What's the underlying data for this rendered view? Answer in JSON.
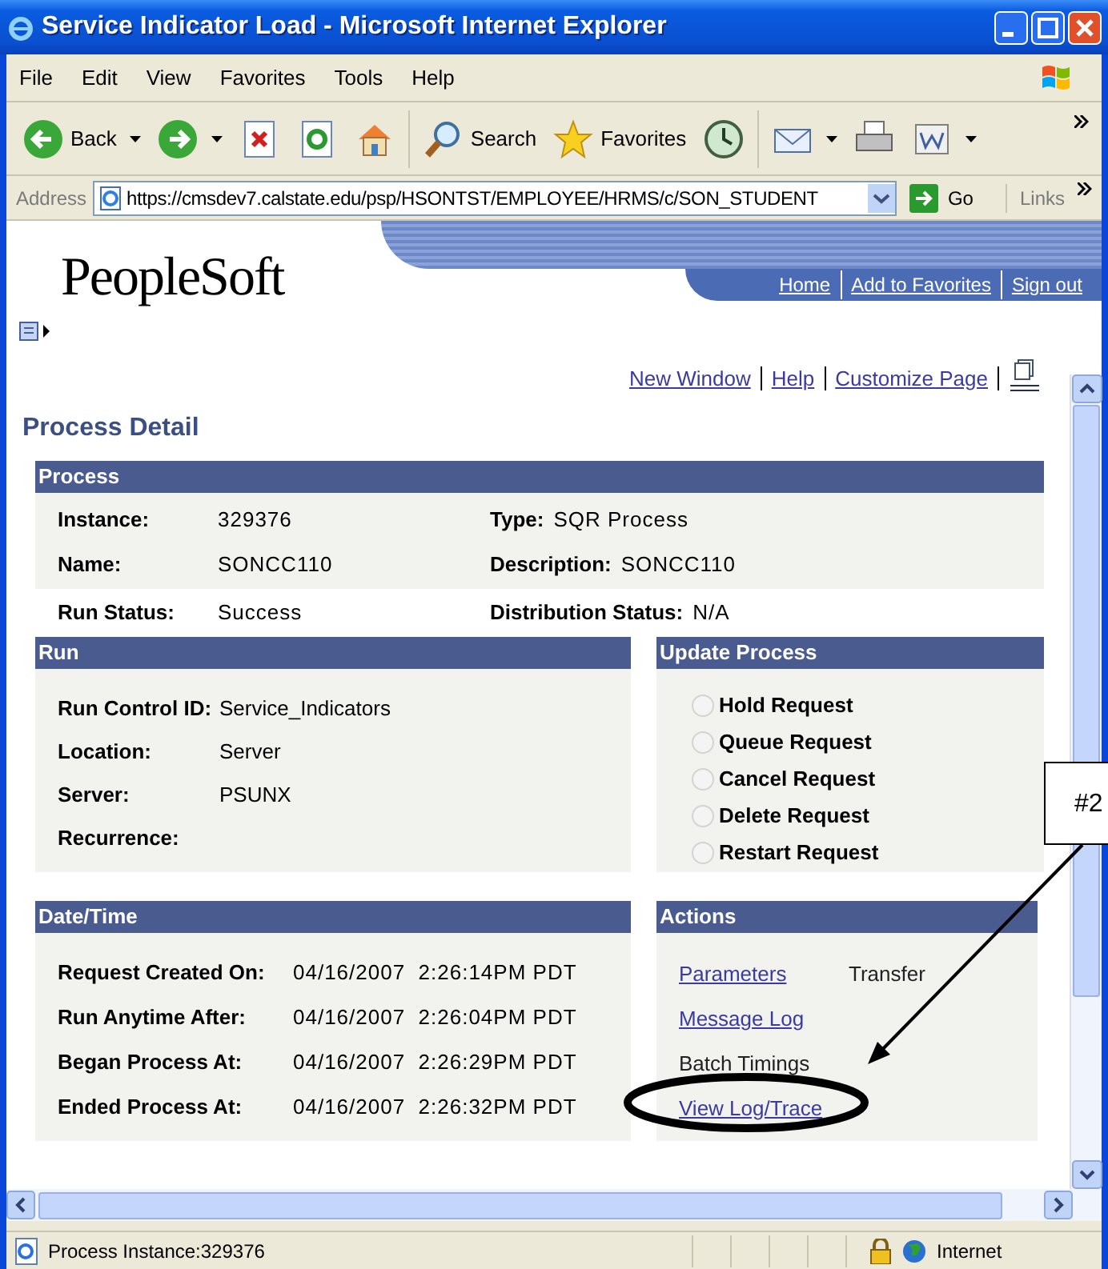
{
  "window": {
    "title": "Service Indicator Load - Microsoft Internet Explorer"
  },
  "menu": [
    "File",
    "Edit",
    "View",
    "Favorites",
    "Tools",
    "Help"
  ],
  "toolbar": [
    {
      "kind": "back",
      "label": "Back"
    },
    {
      "kind": "forward"
    },
    {
      "kind": "stop"
    },
    {
      "kind": "refresh"
    },
    {
      "kind": "home"
    },
    {
      "kind": "search",
      "label": "Search"
    },
    {
      "kind": "favorites",
      "label": "Favorites"
    },
    {
      "kind": "history"
    },
    {
      "kind": "mail"
    },
    {
      "kind": "print"
    },
    {
      "kind": "word"
    }
  ],
  "address": {
    "label": "Address",
    "value": "https://cmsdev7.calstate.edu/psp/HSONTST/EMPLOYEE/HRMS/c/SON_STUDENT",
    "go": "Go",
    "links": "Links"
  },
  "header": {
    "logo": "PeopleSoft",
    "links": [
      "Home",
      "Add to Favorites",
      "Sign out"
    ]
  },
  "page_links": [
    "New Window",
    "Help",
    "Customize Page"
  ],
  "page_title": "Process Detail",
  "process": {
    "title": "Process",
    "rows": [
      {
        "label": "Instance:",
        "value": "329376",
        "label2": "Type:",
        "value2": "SQR Process"
      },
      {
        "label": "Name:",
        "value": "SONCC110",
        "label2": "Description:",
        "value2": "SONCC110"
      }
    ],
    "status": {
      "label": "Run Status:",
      "value": "Success",
      "label2": "Distribution Status:",
      "value2": "N/A"
    }
  },
  "run": {
    "title": "Run",
    "rows": [
      {
        "label": "Run Control ID:",
        "value": "Service_Indicators"
      },
      {
        "label": "Location:",
        "value": "Server"
      },
      {
        "label": "Server:",
        "value": "PSUNX"
      },
      {
        "label": "Recurrence:"
      }
    ]
  },
  "update_process": {
    "title": "Update Process",
    "options": [
      {
        "label": "Hold Request",
        "selected": false
      },
      {
        "label": "Queue Request",
        "selected": false
      },
      {
        "label": "Cancel Request",
        "selected": false
      },
      {
        "label": "Delete Request",
        "selected": false
      },
      {
        "label": "Restart Request",
        "selected": false
      }
    ]
  },
  "date_time": {
    "title": "Date/Time",
    "rows": [
      {
        "label": "Request Created On:",
        "value": "04/16/2007  2:26:14PM PDT"
      },
      {
        "label": "Run Anytime After:",
        "value": "04/16/2007  2:26:04PM PDT"
      },
      {
        "label": "Began Process At:",
        "value": "04/16/2007  2:26:29PM PDT"
      },
      {
        "label": "Ended Process At:",
        "value": "04/16/2007  2:26:32PM PDT"
      }
    ]
  },
  "actions": {
    "title": "Actions",
    "rows": [
      [
        {
          "kind": "link",
          "label": "Parameters"
        },
        {
          "kind": "text",
          "label": "Transfer"
        }
      ],
      [
        {
          "kind": "link",
          "label": "Message Log"
        }
      ],
      [
        {
          "kind": "text",
          "label": "Batch Timings"
        }
      ],
      [
        {
          "kind": "link",
          "label": "View Log/Trace"
        }
      ]
    ]
  },
  "status_bar": {
    "text": "Process Instance:329376",
    "zone": "Internet"
  },
  "annotation": {
    "label": "#2"
  }
}
